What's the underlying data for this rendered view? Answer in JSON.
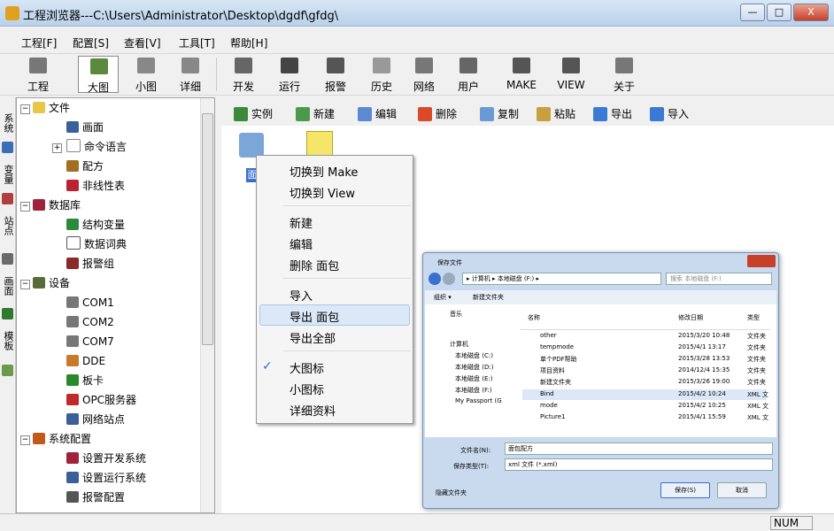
{
  "window": {
    "title": "工程浏览器---C:\\Users\\Administrator\\Desktop\\dgdf\\gfdg\\",
    "minimize": "—",
    "maximize": "□",
    "close": "X"
  },
  "menu": [
    "工程[F]",
    "配置[S]",
    "查看[V]",
    "工具[T]",
    "帮助[H]"
  ],
  "toolbar": [
    "工程",
    "大图",
    "小图",
    "详细",
    "开发",
    "运行",
    "报警",
    "历史",
    "网络",
    "用户",
    "MAKE",
    "VIEW",
    "关于"
  ],
  "vtabs": [
    "系统",
    "变量",
    "站点",
    "画面",
    "模板"
  ],
  "tree": [
    "文件",
    "画面",
    "命令语言",
    "配方",
    "非线性表",
    "数据库",
    "结构变量",
    "数据词典",
    "报警组",
    "设备",
    "COM1",
    "COM2",
    "COM7",
    "DDE",
    "板卡",
    "OPC服务器",
    "网络站点",
    "系统配置",
    "设置开发系统",
    "设置运行系统",
    "报警配置"
  ],
  "rtools": [
    "实例",
    "新建",
    "编辑",
    "删除",
    "复制",
    "粘贴",
    "导出",
    "导入"
  ],
  "items": [
    "面"
  ],
  "context_menu": [
    "切换到 Make",
    "切换到 View",
    "新建",
    "编辑",
    "删除 面包",
    "导入",
    "导出 面包",
    "导出全部",
    "大图标",
    "小图标",
    "详细资料"
  ],
  "check": "✓",
  "dialog": {
    "title": "保存文件",
    "path": "▸ 计算机 ▸ 本地磁盘 (F:) ▸",
    "search_placeholder": "搜索 本地磁盘 (F:)",
    "organize": "组织 ▾",
    "newfolder": "新建文件夹",
    "columns": [
      "名称",
      "修改日期",
      "类型"
    ],
    "sidebar": [
      "音乐",
      "计算机",
      "本地磁盘 (C:)",
      "本地磁盘 (D:)",
      "本地磁盘 (E:)",
      "本地磁盘 (F:)",
      "My Passport (G"
    ],
    "files": [
      {
        "name": "other",
        "date": "2015/3/20 10:48",
        "type": "文件夹"
      },
      {
        "name": "tempmode",
        "date": "2015/4/1 13:17",
        "type": "文件夹"
      },
      {
        "name": "单个PDF帮助",
        "date": "2015/3/28 13:53",
        "type": "文件夹"
      },
      {
        "name": "项目资料",
        "date": "2014/12/4 15:35",
        "type": "文件夹"
      },
      {
        "name": "新建文件夹",
        "date": "2015/3/26 19:00",
        "type": "文件夹"
      },
      {
        "name": "Bind",
        "date": "2015/4/2 10:24",
        "type": "XML 文"
      },
      {
        "name": "mode",
        "date": "2015/4/2 10:25",
        "type": "XML 文"
      },
      {
        "name": "Picture1",
        "date": "2015/4/1 15:59",
        "type": "XML 文"
      }
    ],
    "filename_label": "文件名(N):",
    "filename": "面包配方",
    "filetype_label": "保存类型(T):",
    "filetype": "xml 文件 (*.xml)",
    "hide_folders": "隐藏文件夹",
    "save": "保存(S)",
    "cancel": "取消"
  },
  "status": {
    "num": "NUM"
  }
}
